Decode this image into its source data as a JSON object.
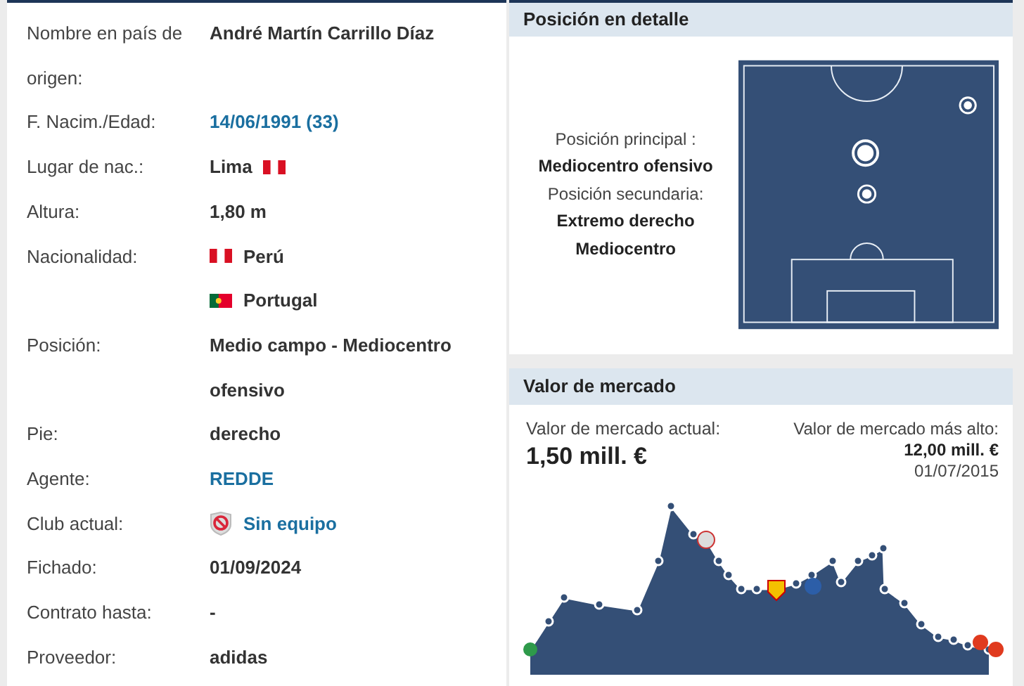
{
  "profile": {
    "rows": [
      {
        "label": "Nombre en país de origen:",
        "values": [
          {
            "text": "André Martín Carrillo Díaz",
            "link": false
          }
        ]
      },
      {
        "label": "F. Nacim./Edad:",
        "values": [
          {
            "text": "14/06/1991 (33)",
            "link": true
          }
        ]
      },
      {
        "label": "Lugar de nac.:",
        "values": [
          {
            "text": "Lima",
            "link": false
          }
        ]
      },
      {
        "label": "Altura:",
        "values": [
          {
            "text": "1,80 m",
            "link": false
          }
        ]
      },
      {
        "label": "Nacionalidad:",
        "values": [
          {
            "text": "Perú",
            "link": false
          },
          {
            "text": "Portugal",
            "link": false
          }
        ]
      },
      {
        "label": "Posición:",
        "values": [
          {
            "text": "Medio campo - Mediocentro ofensivo",
            "link": false
          }
        ]
      },
      {
        "label": "Pie:",
        "values": [
          {
            "text": "derecho",
            "link": false
          }
        ]
      },
      {
        "label": "Agente:",
        "values": [
          {
            "text": "REDDE",
            "link": true
          }
        ]
      },
      {
        "label": "Club actual:",
        "values": [
          {
            "text": "Sin equipo",
            "link": true
          }
        ]
      },
      {
        "label": "Fichado:",
        "values": [
          {
            "text": "01/09/2024",
            "link": false
          }
        ]
      },
      {
        "label": "Contrato hasta:",
        "values": [
          {
            "text": "-",
            "link": false
          }
        ]
      },
      {
        "label": "Proveedor:",
        "values": [
          {
            "text": "adidas",
            "link": false
          }
        ]
      }
    ]
  },
  "position_detail": {
    "title": "Posición en detalle",
    "main_label": "Posición principal :",
    "main": "Mediocentro ofensivo",
    "secondary_label": "Posición secundaria:",
    "secondary": [
      "Extremo derecho",
      "Mediocentro"
    ]
  },
  "market_value": {
    "title": "Valor de mercado",
    "current_label": "Valor de mercado actual:",
    "current": "1,50 mill. €",
    "highest_label": "Valor de mercado más alto:",
    "highest": "12,00 mill. €",
    "highest_date": "01/07/2015"
  }
}
